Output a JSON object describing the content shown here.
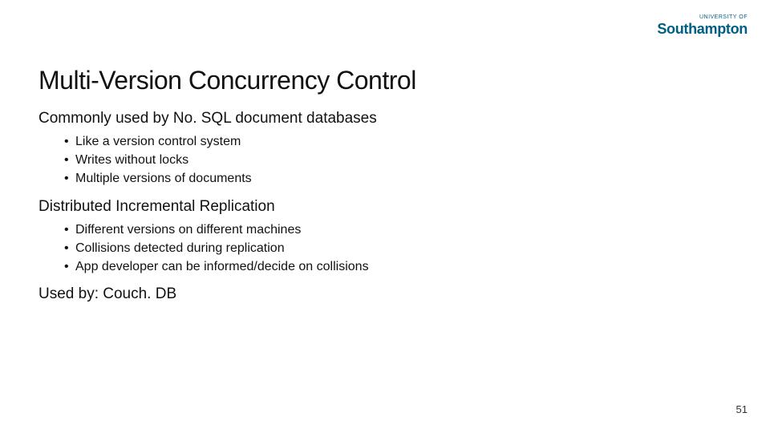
{
  "logo": {
    "prefix": "UNIVERSITY OF",
    "name": "Southampton"
  },
  "title": "Multi-Version Concurrency Control",
  "sections": [
    {
      "heading": "Commonly used by No. SQL document databases",
      "bullets": [
        "Like a version control system",
        "Writes without locks",
        "Multiple versions of documents"
      ]
    },
    {
      "heading": "Distributed Incremental Replication",
      "bullets": [
        "Different versions on different machines",
        "Collisions detected during replication",
        "App developer can be informed/decide on collisions"
      ]
    }
  ],
  "used_by": "Used by: Couch. DB",
  "page_number": "51"
}
